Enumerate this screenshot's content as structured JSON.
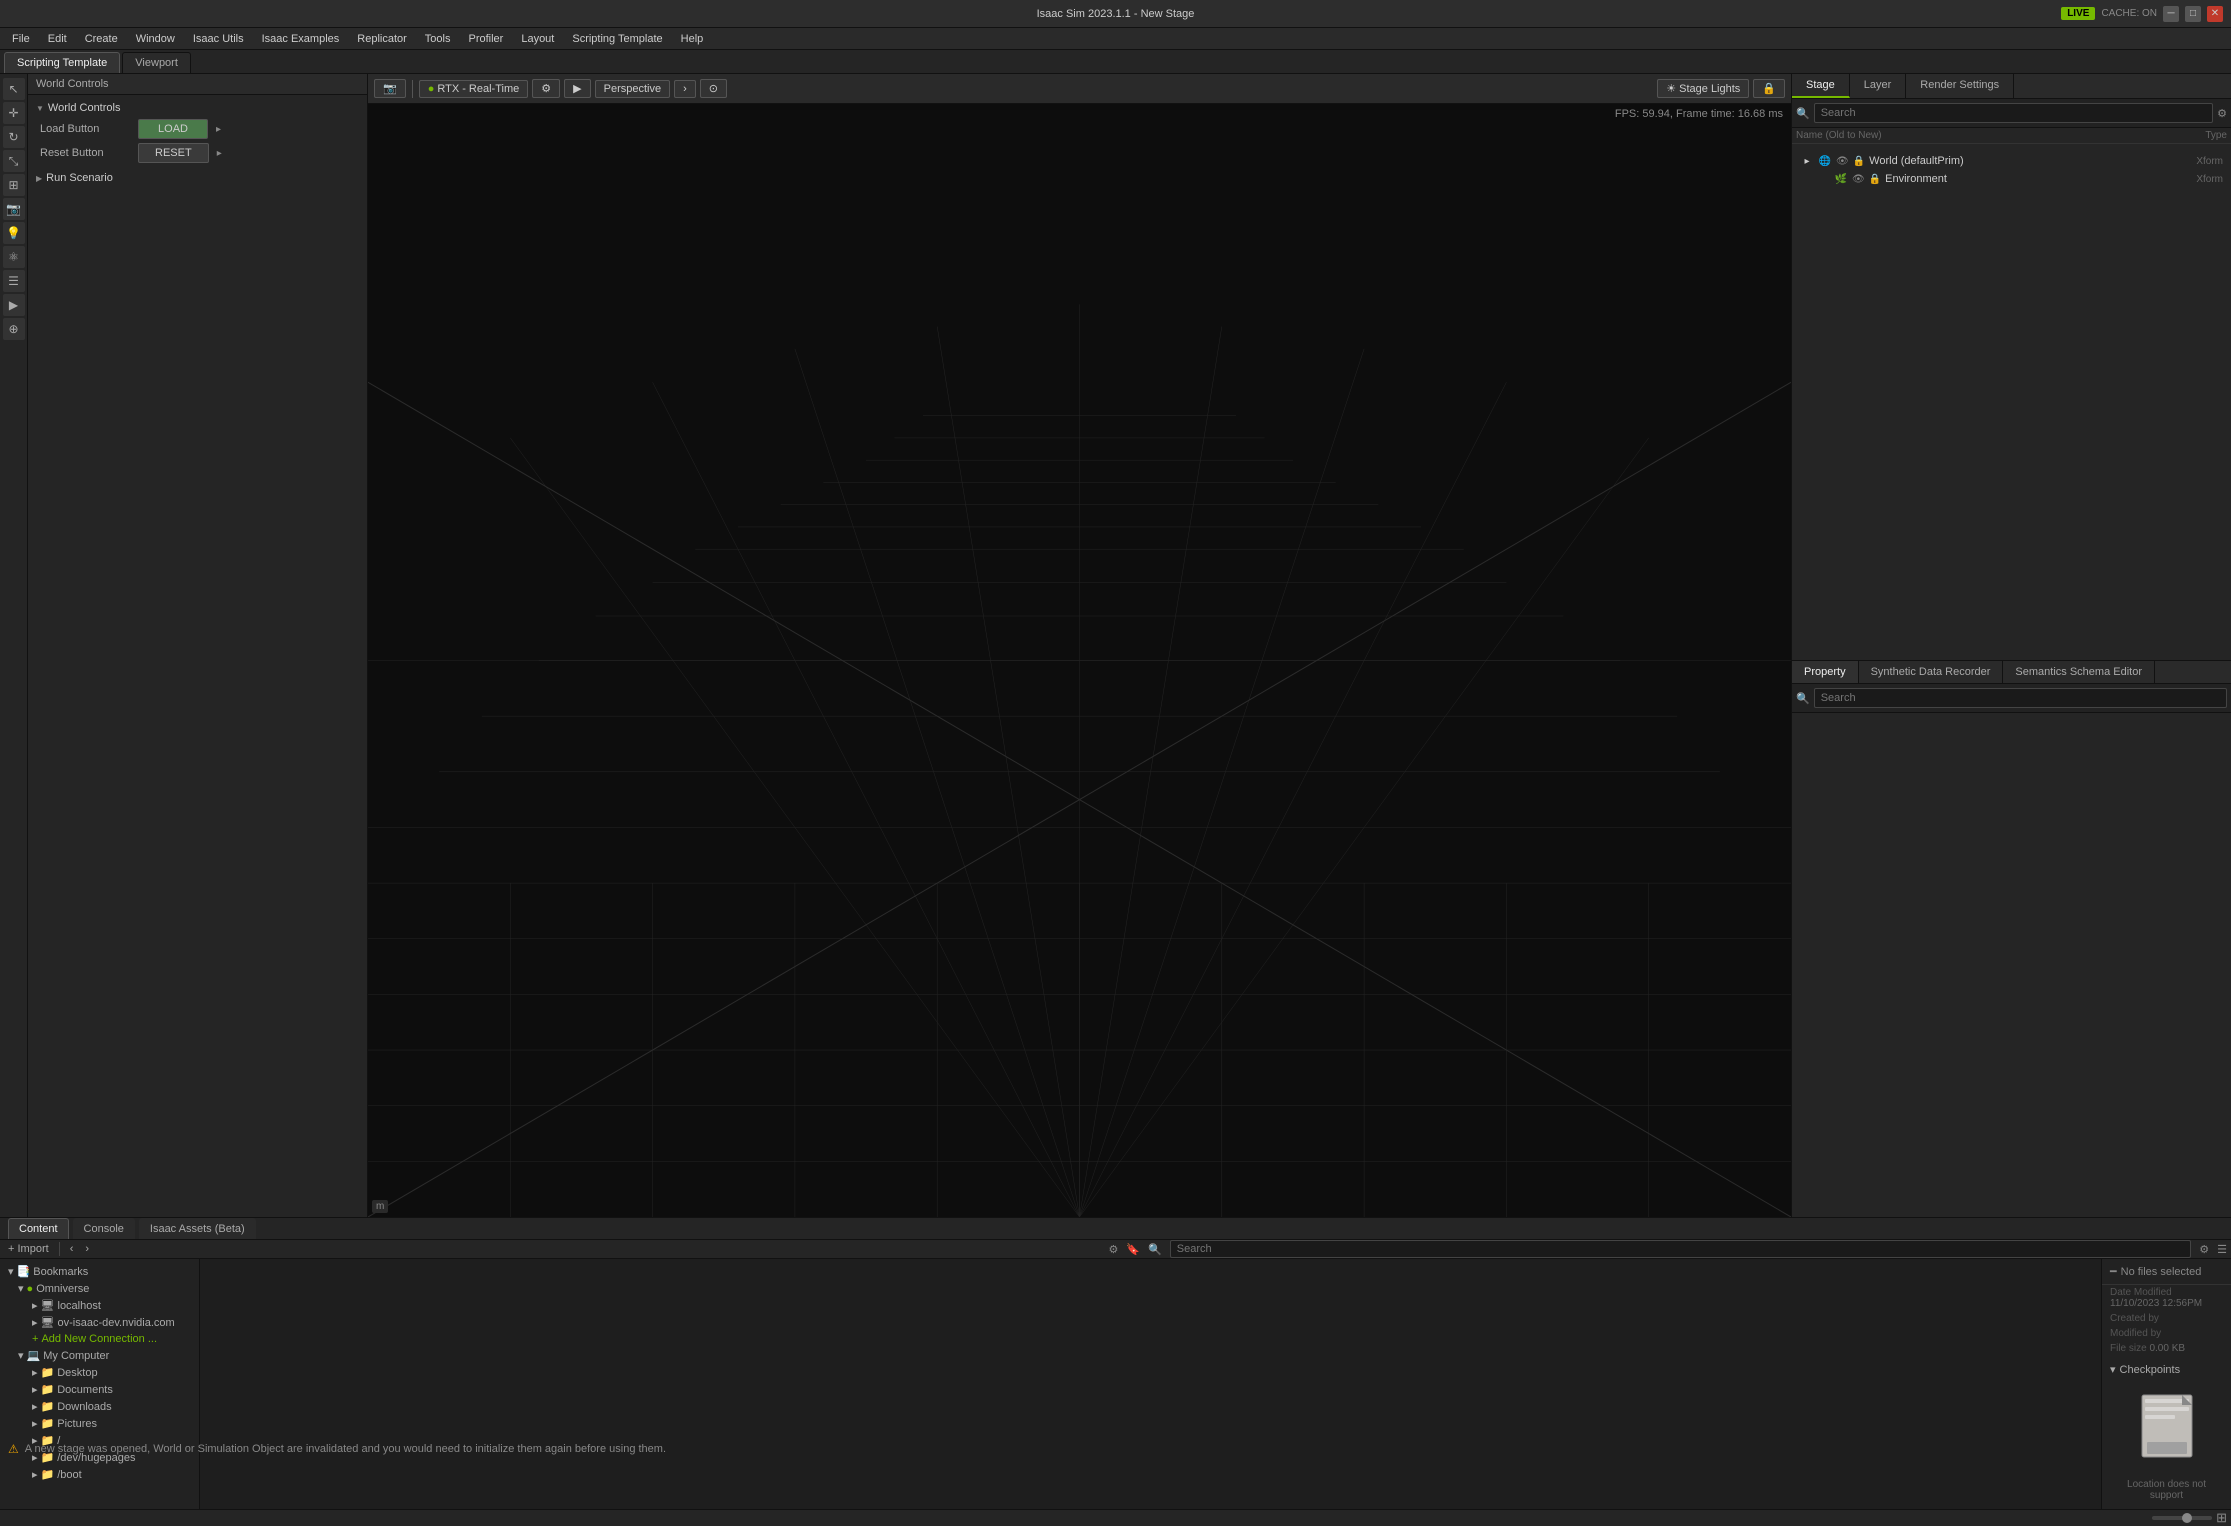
{
  "titlebar": {
    "title": "Isaac Sim 2023.1.1 - New Stage",
    "controls": [
      "minimize",
      "maximize",
      "close"
    ]
  },
  "menubar": {
    "items": [
      "File",
      "Edit",
      "Create",
      "Window",
      "Isaac Utils",
      "Isaac Examples",
      "Replicator",
      "Tools",
      "Profiler",
      "Layout",
      "Scripting Template",
      "Help"
    ]
  },
  "tabs": {
    "scripting": "Scripting Template",
    "viewport": "Viewport"
  },
  "live_badge": "LIVE",
  "cache_label": "CACHE: ON",
  "left_panel": {
    "world_controls": {
      "title": "World Controls",
      "load_button_label": "LOAD",
      "reset_button_label": "RESET",
      "load_label": "Load Button",
      "reset_label": "Reset Button"
    },
    "run_scenario": {
      "title": "Run Scenario"
    }
  },
  "viewport": {
    "mode": "RTX - Real-Time",
    "perspective": "Perspective",
    "fps": "FPS: 59.94, Frame time: 16.68 ms",
    "unit": "m",
    "stage_lights": "Stage Lights",
    "buttons": [
      "camera-icon",
      "settings-icon",
      "play-icon",
      "stop-icon"
    ]
  },
  "right_panel": {
    "stage_tabs": [
      "Stage",
      "Layer",
      "Render Settings"
    ],
    "active_stage_tab": "Stage",
    "search_placeholder": "Search",
    "tree_header_left": "Name (Old to New)",
    "tree_header_right": "Type",
    "tree_items": [
      {
        "id": "world",
        "label": "World (defaultPrim)",
        "type": "Xform",
        "indent": 0,
        "icon": "🌐"
      },
      {
        "id": "environment",
        "label": "Environment",
        "type": "Xform",
        "indent": 1,
        "icon": "🌿"
      }
    ],
    "prop_tabs": [
      "Property",
      "Synthetic Data Recorder",
      "Semantics Schema Editor"
    ],
    "active_prop_tab": "Property",
    "prop_search_placeholder": "Search"
  },
  "bottom_panel": {
    "tabs": [
      "Content",
      "Console",
      "Isaac Assets (Beta)"
    ],
    "active_tab": "Content",
    "toolbar": {
      "import_label": "Import",
      "back_label": "‹",
      "forward_label": "›",
      "search_placeholder": "Search"
    },
    "content_left": {
      "items": [
        {
          "label": "Bookmarks",
          "indent": 0,
          "icon": "📑",
          "type": "folder",
          "expanded": true
        },
        {
          "label": "Omniverse",
          "indent": 1,
          "icon": "○",
          "type": "folder",
          "expanded": true
        },
        {
          "label": "localhost",
          "indent": 2,
          "icon": "🖥",
          "type": "folder"
        },
        {
          "label": "ov-isaac-dev.nvidia.com",
          "indent": 2,
          "icon": "🖥",
          "type": "folder"
        },
        {
          "label": "Add New Connection ...",
          "indent": 2,
          "icon": "+",
          "type": "action"
        },
        {
          "label": "My Computer",
          "indent": 1,
          "icon": "💻",
          "type": "folder",
          "expanded": true
        },
        {
          "label": "Desktop",
          "indent": 2,
          "icon": "📁",
          "type": "folder"
        },
        {
          "label": "Documents",
          "indent": 2,
          "icon": "📁",
          "type": "folder"
        },
        {
          "label": "Downloads",
          "indent": 2,
          "icon": "📁",
          "type": "folder"
        },
        {
          "label": "Pictures",
          "indent": 2,
          "icon": "📁",
          "type": "folder"
        },
        {
          "label": "/",
          "indent": 2,
          "icon": "📁",
          "type": "folder"
        },
        {
          "label": "/dev/hugepages",
          "indent": 2,
          "icon": "📁",
          "type": "folder"
        },
        {
          "label": "/boot",
          "indent": 2,
          "icon": "📁",
          "type": "folder"
        }
      ]
    },
    "content_right": {
      "no_files": "No files selected",
      "date_modified_label": "Date Modified",
      "date_modified_value": "11/10/2023 12:56PM",
      "created_by_label": "Created by",
      "created_by_value": "",
      "modified_by_label": "Modified by",
      "modified_by_value": "",
      "file_size_label": "File size",
      "file_size_value": "0.00 KB",
      "checkpoints_title": "Checkpoints",
      "location_text": "Location does not support"
    }
  },
  "statusbar": {
    "warning": "⚠",
    "message": "A new stage was opened, World or Simulation Object are invalidated and you would need to initialize them again before using them."
  },
  "icons": {
    "search": "🔍",
    "filter": "⚙",
    "eye": "👁",
    "triangle_right": "▶",
    "triangle_down": "▼",
    "triangle_small_right": "▸",
    "triangle_small_down": "▾",
    "camera": "📷",
    "grid": "⊞",
    "layers": "☰"
  }
}
